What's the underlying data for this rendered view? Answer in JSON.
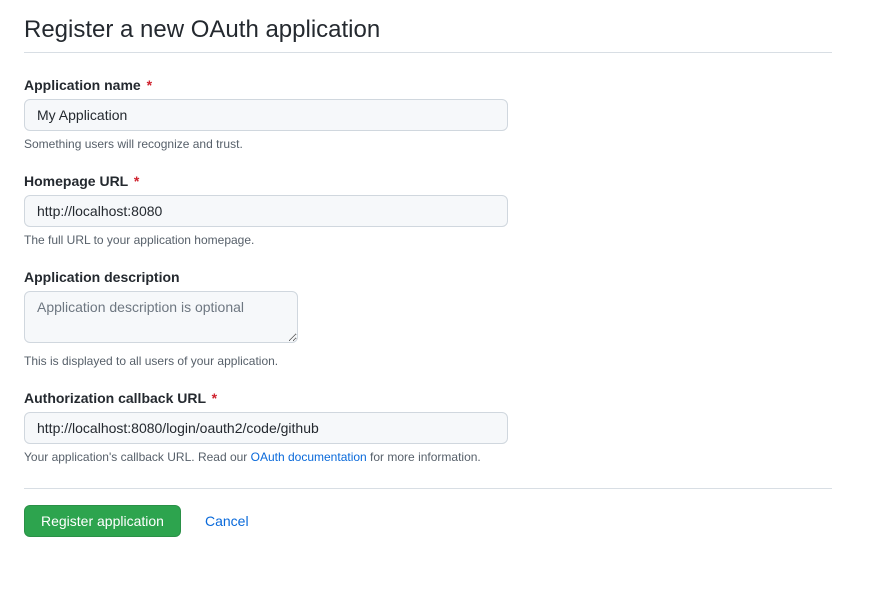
{
  "heading": "Register a new OAuth application",
  "appName": {
    "label": "Application name",
    "value": "My Application",
    "hint": "Something users will recognize and trust."
  },
  "homepageUrl": {
    "label": "Homepage URL",
    "value": "http://localhost:8080",
    "hint": "The full URL to your application homepage."
  },
  "appDescription": {
    "label": "Application description",
    "placeholder": "Application description is optional",
    "hint": "This is displayed to all users of your application."
  },
  "callbackUrl": {
    "label": "Authorization callback URL",
    "value": "http://localhost:8080/login/oauth2/code/github",
    "hintPrefix": "Your application's callback URL. Read our ",
    "hintLink": "OAuth documentation",
    "hintSuffix": " for more information."
  },
  "actions": {
    "submit": "Register application",
    "cancel": "Cancel"
  }
}
